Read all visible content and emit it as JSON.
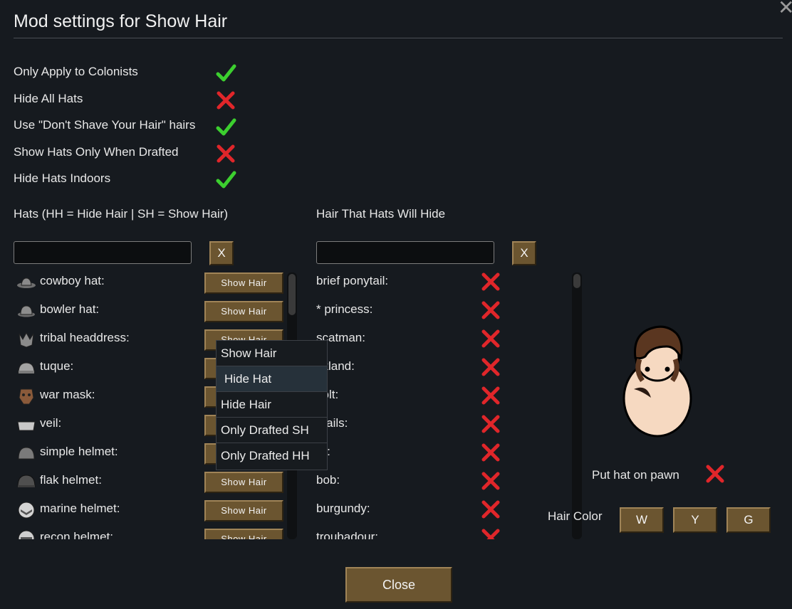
{
  "window": {
    "title": "Mod settings for Show Hair",
    "close_glyph": "✕"
  },
  "settings": [
    {
      "label": "Only Apply to Colonists",
      "value": "check"
    },
    {
      "label": "Hide All Hats",
      "value": "cross"
    },
    {
      "label": "Use \"Don't Shave Your Hair\" hairs",
      "value": "check"
    },
    {
      "label": "Show Hats Only When Drafted",
      "value": "cross"
    },
    {
      "label": "Hide Hats Indoors",
      "value": "check"
    }
  ],
  "hats": {
    "header": "Hats (HH = Hide Hair | SH = Show Hair)",
    "search_value": "",
    "clear_label": "X",
    "items": [
      {
        "name": "cowboy hat:",
        "icon": "cowboy-hat-icon",
        "mode": "Show Hair"
      },
      {
        "name": "bowler hat:",
        "icon": "bowler-hat-icon",
        "mode": "Show Hair"
      },
      {
        "name": "tribal headdress:",
        "icon": "tribal-headdress-icon",
        "mode": "Show Hair"
      },
      {
        "name": "tuque:",
        "icon": "tuque-icon",
        "mode": "Show Hair"
      },
      {
        "name": "war mask:",
        "icon": "war-mask-icon",
        "mode": "Show Hair"
      },
      {
        "name": "veil:",
        "icon": "veil-icon",
        "mode": "Show Hair"
      },
      {
        "name": "simple helmet:",
        "icon": "simple-helmet-icon",
        "mode": "Show Hair"
      },
      {
        "name": "flak helmet:",
        "icon": "flak-helmet-icon",
        "mode": "Show Hair"
      },
      {
        "name": "marine helmet:",
        "icon": "marine-helmet-icon",
        "mode": "Show Hair"
      },
      {
        "name": "recon helmet:",
        "icon": "recon-helmet-icon",
        "mode": "Show Hair"
      }
    ]
  },
  "dropdown": {
    "options": [
      "Show Hair",
      "Hide Hat",
      "Hide Hair",
      "Only Drafted SH",
      "Only Drafted HH"
    ],
    "hovered": "Hide Hat"
  },
  "hair": {
    "header": "Hair That Hats Will Hide",
    "search_value": "",
    "clear_label": "X",
    "items": [
      {
        "name": "brief ponytail:",
        "hidden": false
      },
      {
        "name": "* princess:",
        "hidden": false
      },
      {
        "name": "scatman:",
        "hidden": false
      },
      {
        "name": "ckland:",
        "hidden": false
      },
      {
        "name": "volt:",
        "hidden": false
      },
      {
        "name": "gtails:",
        "hidden": false
      },
      {
        "name": "ro:",
        "hidden": false
      },
      {
        "name": "bob:",
        "hidden": false
      },
      {
        "name": "burgundy:",
        "hidden": false
      },
      {
        "name": "troubadour:",
        "hidden": false
      }
    ]
  },
  "preview": {
    "put_hat_label": "Put hat on pawn",
    "put_hat_value": "cross",
    "hair_color_label": "Hair Color",
    "color_buttons": [
      "W",
      "Y",
      "G"
    ]
  },
  "footer": {
    "close_label": "Close"
  },
  "colors": {
    "background": "#161a1f",
    "check": "#3ccf2f",
    "cross": "#e0262a",
    "button": "#6b5530"
  }
}
